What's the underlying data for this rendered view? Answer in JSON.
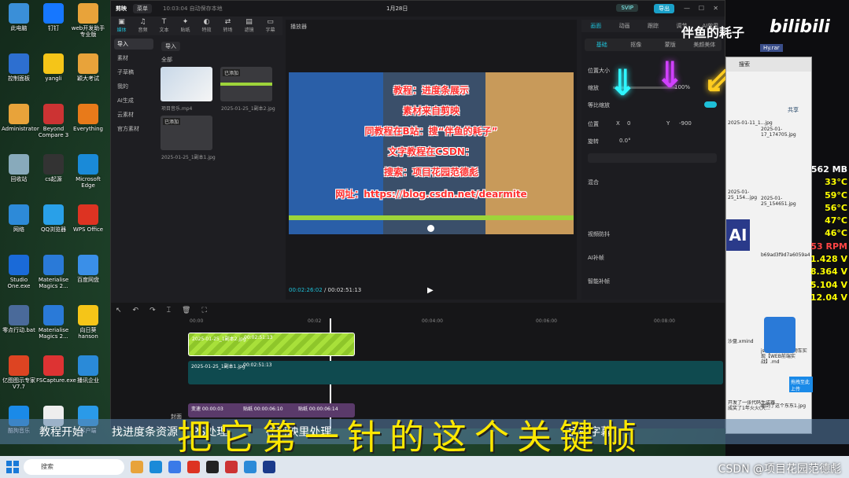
{
  "desktop": {
    "icons": [
      {
        "label": "此电脑",
        "color": "#3a8fd8"
      },
      {
        "label": "钉钉",
        "color": "#1677ff"
      },
      {
        "label": "web开发助手专业版",
        "color": "#e8a33a"
      },
      {
        "label": "控制面板",
        "color": "#2d6fd0"
      },
      {
        "label": "yangli",
        "color": "#f5c518"
      },
      {
        "label": "颖大考试",
        "color": "#e8a33a"
      },
      {
        "label": "Administrator",
        "color": "#e8a33a"
      },
      {
        "label": "Beyond Compare 3",
        "color": "#c33"
      },
      {
        "label": "Everything",
        "color": "#e87a1a"
      },
      {
        "label": "回收站",
        "color": "#8ab"
      },
      {
        "label": "cs起源",
        "color": "#333"
      },
      {
        "label": "Microsoft Edge",
        "color": "#1a8ad8"
      },
      {
        "label": "网络",
        "color": "#2d8ad8"
      },
      {
        "label": "QQ浏览器",
        "color": "#29a0e8"
      },
      {
        "label": "WPS Office",
        "color": "#d32"
      },
      {
        "label": "Studio One.exe",
        "color": "#1a6ad8"
      },
      {
        "label": "Materialise Magics 2...",
        "color": "#2a7ad8"
      },
      {
        "label": "百度网盘",
        "color": "#3a8fe8"
      },
      {
        "label": "零点行动.bat",
        "color": "#4a6a9a"
      },
      {
        "label": "Materialise Magics 2...",
        "color": "#2a7ad8"
      },
      {
        "label": "向日葵hanson",
        "color": "#f5c518"
      },
      {
        "label": "亿图图示专家V7.7",
        "color": "#d42"
      },
      {
        "label": "FSCapture.exe",
        "color": "#d33"
      },
      {
        "label": "播讯企业",
        "color": "#2a8ad8"
      },
      {
        "label": "酷狗音乐",
        "color": "#1a8ae8"
      },
      {
        "label": "",
        "color": "#eee"
      },
      {
        "label": "客户端",
        "color": "#2a9ae8"
      }
    ]
  },
  "capcut": {
    "logo": "剪映",
    "menu": "菜单",
    "autosave": "10:03:04 自动保存本地",
    "project": "1月28日",
    "svip": "SVIP",
    "share": "导出",
    "tools": [
      {
        "g": "▣",
        "l": "媒体"
      },
      {
        "g": "♫",
        "l": "音频"
      },
      {
        "g": "T",
        "l": "文本"
      },
      {
        "g": "✦",
        "l": "贴纸"
      },
      {
        "g": "◐",
        "l": "特效"
      },
      {
        "g": "⇄",
        "l": "转场"
      },
      {
        "g": "▤",
        "l": "滤镜"
      },
      {
        "g": "▭",
        "l": "字幕"
      }
    ],
    "nav": [
      "导入",
      "素材",
      "子草稿",
      "我的",
      "AI生成",
      "云素材",
      "官方素材"
    ],
    "import_btn": "导入",
    "all": "全部",
    "clips": [
      {
        "name": "项目音乐.mp4",
        "badge": ""
      },
      {
        "name": "2025-01-25_1副本2.jpg",
        "badge": "已添加"
      },
      {
        "name": "2025-01-25_1副本1.jpg",
        "badge": "已添加"
      }
    ],
    "player_title": "播放器",
    "video_lines": [
      "教程：进度条展示",
      "素材来自剪映",
      "同教程在B站：搜“伴鱼的耗子”",
      "文字教程在CSDN：",
      "搜索：项目花园范德彪",
      "网址：https://blog.csdn.net/dearmite"
    ],
    "time_current": "00:02:26:02",
    "time_total": "00:02:51:13",
    "props_tabs": [
      "画面",
      "动画",
      "跟踪",
      "调节",
      "AI效果"
    ],
    "sub_tabs": [
      "基础",
      "抠像",
      "蒙版",
      "美颜美体"
    ],
    "props": {
      "position_size": "位置大小",
      "scale": "缩放",
      "scale_val": "100%",
      "uniform": "等比缩放",
      "pos": "位置",
      "x": "X",
      "x_val": "0",
      "y": "Y",
      "y_val": "-900",
      "rotate": "旋转",
      "rot_val": "0.0°",
      "blend": "混合",
      "video_stab": "视频防抖",
      "ai_stab": "AI补帧",
      "smart": "智能补帧"
    },
    "timeline": {
      "clips": [
        {
          "name": "2025-01-25_1副本2.jpg",
          "dur": "00:02:51:13"
        },
        {
          "name": "2025-01-25_1副本1.jpg",
          "dur": "00:02:51:13"
        }
      ],
      "cover": "封面",
      "ruler": [
        "00:00",
        "00:02",
        "00:04:00",
        "00:06:00",
        "00:08:00"
      ],
      "audio_clips": [
        "变速 00:00:03",
        "贴纸 00:00:06:10",
        "贴纸 00:00:06:14"
      ]
    }
  },
  "overlay": {
    "watermark": "伴鱼的耗子",
    "bili": "bilibili",
    "file": "Hy.rar"
  },
  "explorer": {
    "search": "搜索",
    "share": "共享",
    "files": [
      "2025-01-11_1...jpg",
      "2025-01-17_174705.jpg",
      "2025-01-25_154...jpg",
      "2025-01-25_154651.jpg",
      "b69ad3f9d7a6059a4f9264f6e34349b023bba9d.jpg",
      "沙盘.xmind",
      "js的大作业，购物车实现【WEB前端实战】.md",
      "开发了一张代码生成器成奖了1年火火(大...",
      "刷到了这个东东1.jpg"
    ],
    "ai": "AI",
    "upload": "拖拽至此上传"
  },
  "hw": {
    "values": [
      "562 MB",
      "33°C",
      "59°C",
      "56°C",
      "47°C",
      "46°C",
      "53 RPM",
      "1.428 V",
      "8.364 V",
      "5.104 V",
      "12.04 V"
    ],
    "colors": [
      "#fff",
      "#ff0",
      "#ff0",
      "#ff0",
      "#ff0",
      "#ff0",
      "#f44",
      "#ff0",
      "#ff0",
      "#ff0",
      "#ff0"
    ]
  },
  "subtitles": {
    "items": [
      "教程开始",
      "找进度条资源",
      "PS处理",
      "在剪映里处理",
      "",
      "",
      "",
      "目标字幕"
    ],
    "big": "把它第一针的这个关键帧"
  },
  "taskbar": {
    "search": "搜索",
    "csdn": "CSDN @项目花园范德彪"
  }
}
